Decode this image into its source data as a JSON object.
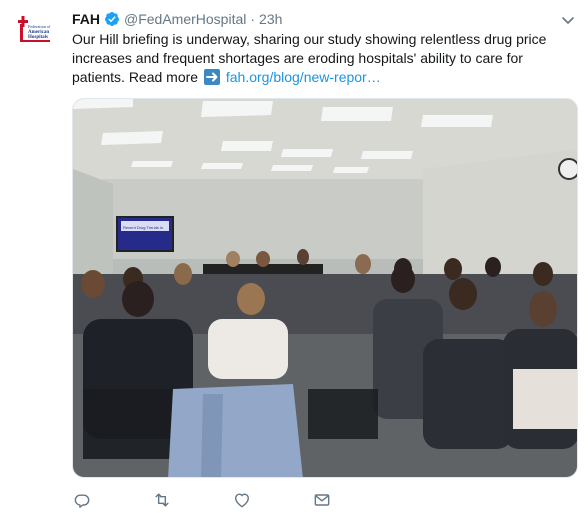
{
  "tweet": {
    "author_name": "FAH",
    "handle": "@FedAmerHospital",
    "separator": "·",
    "time": "23h",
    "text_before_link": "Our Hill briefing is underway, sharing our study showing relentless drug price increases and frequent shortages are eroding hospitals' ability to care for patients. Read more",
    "link_text": "fah.org/blog/new-repor…",
    "avatar_lines": [
      "Federation of",
      "American",
      "Hospitals"
    ],
    "screen_text": "Recent Drug Trends in"
  },
  "icons": {
    "verified": "verified-badge-icon",
    "caret": "chevron-down-icon",
    "arrow": "right-arrow-emoji-icon",
    "reply": "reply-icon",
    "retweet": "retweet-icon",
    "like": "heart-icon",
    "dm": "envelope-icon"
  },
  "colors": {
    "text": "#14171a",
    "secondary": "#657786",
    "link": "#1b95e0",
    "verified": "#1da1f2",
    "avatar_red": "#c8102e",
    "avatar_blue": "#1f3c88"
  }
}
